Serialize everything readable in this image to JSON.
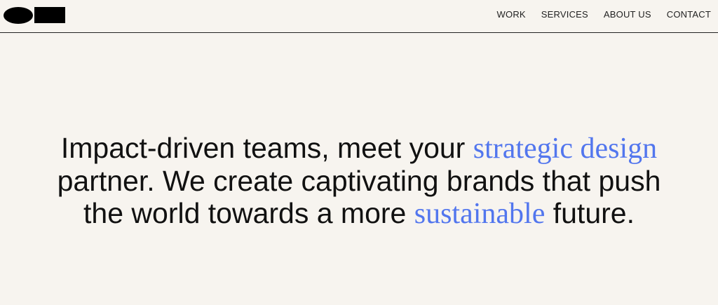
{
  "header": {
    "nav": [
      {
        "label": "WORK"
      },
      {
        "label": "SERVICES"
      },
      {
        "label": "ABOUT US"
      },
      {
        "label": "CONTACT"
      }
    ]
  },
  "hero": {
    "line1_a": "Impact-driven teams, meet your ",
    "line1_accent": "strategic design",
    "line2": "partner. We create captivating brands that push",
    "line3_a": "the world towards a more ",
    "line3_accent": "sustainable",
    "line3_b": " future.",
    "accent_color": "#5276ee"
  },
  "theme": {
    "background": "#f7f4ef",
    "text": "#111111"
  }
}
